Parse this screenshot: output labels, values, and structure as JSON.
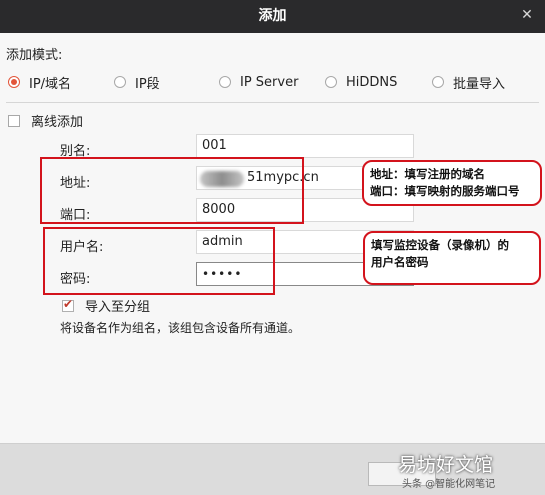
{
  "window": {
    "title": "添加",
    "close_icon": "close-icon"
  },
  "mode": {
    "label": "添加模式:",
    "options": [
      {
        "label": "IP/域名",
        "selected": true
      },
      {
        "label": "IP段",
        "selected": false
      },
      {
        "label": "IP Server",
        "selected": false
      },
      {
        "label": "HiDDNS",
        "selected": false
      },
      {
        "label": "批量导入",
        "selected": false
      }
    ]
  },
  "offline": {
    "label": "离线添加",
    "checked": false
  },
  "form": {
    "alias_label": "别名:",
    "alias_value": "001",
    "address_label": "地址:",
    "address_value": "51mypc.cn",
    "port_label": "端口:",
    "port_value": "8000",
    "username_label": "用户名:",
    "username_value": "admin",
    "password_label": "密码:",
    "password_value": "•••••"
  },
  "import_group": {
    "label": "导入至分组",
    "checked": true
  },
  "hint": "将设备名作为组名，该组包含设备所有通道。",
  "callouts": {
    "address_port_line1": "地址：填写注册的域名",
    "address_port_line2": "端口：填写映射的服务端口号",
    "credentials_line1": "填写监控设备（录像机）的",
    "credentials_line2": "用户名密码"
  },
  "watermark": {
    "main": "易坊好文馆",
    "sub": "头条 @智能化网笔记"
  },
  "colors": {
    "accent": "#e2553a",
    "annotation_red": "#d3131c",
    "titlebar": "#2a2a2c"
  }
}
